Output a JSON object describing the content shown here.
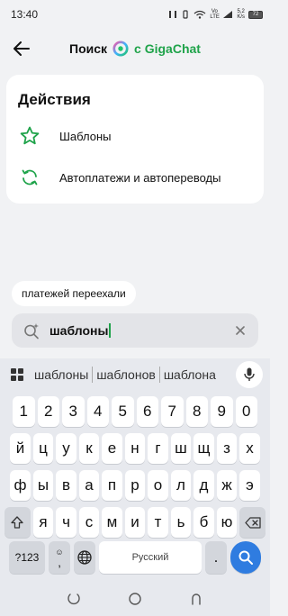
{
  "status_bar": {
    "time": "13:40",
    "network_label": "Vo LTE",
    "net_speed_value": "5,2",
    "net_speed_unit": "K/s",
    "battery": "72"
  },
  "header": {
    "title": "Поиск",
    "brand": "с GigaChat"
  },
  "actions": {
    "title": "Действия",
    "items": [
      {
        "label": "Шаблоны",
        "icon": "star-outline-icon"
      },
      {
        "label": "Автоплатежи и автопереводы",
        "icon": "refresh-arrows-icon"
      }
    ]
  },
  "chip": {
    "label": "платежей переехали"
  },
  "search": {
    "value": "шаблоны"
  },
  "keyboard": {
    "suggestions": [
      "шаблоны",
      "шаблонов",
      "шаблона"
    ],
    "row1": [
      "1",
      "2",
      "3",
      "4",
      "5",
      "6",
      "7",
      "8",
      "9",
      "0"
    ],
    "row2": [
      "й",
      "ц",
      "у",
      "к",
      "е",
      "н",
      "г",
      "ш",
      "щ",
      "з",
      "х"
    ],
    "row3": [
      "ф",
      "ы",
      "в",
      "а",
      "п",
      "р",
      "о",
      "л",
      "д",
      "ж",
      "э"
    ],
    "row4": [
      "я",
      "ч",
      "с",
      "м",
      "и",
      "т",
      "ь",
      "б",
      "ю"
    ],
    "symbols_label": "?123",
    "comma": ",",
    "space_label": "Русский",
    "period": "."
  },
  "colors": {
    "accent_green": "#1fa34a",
    "enter_blue": "#2f7ce0"
  }
}
